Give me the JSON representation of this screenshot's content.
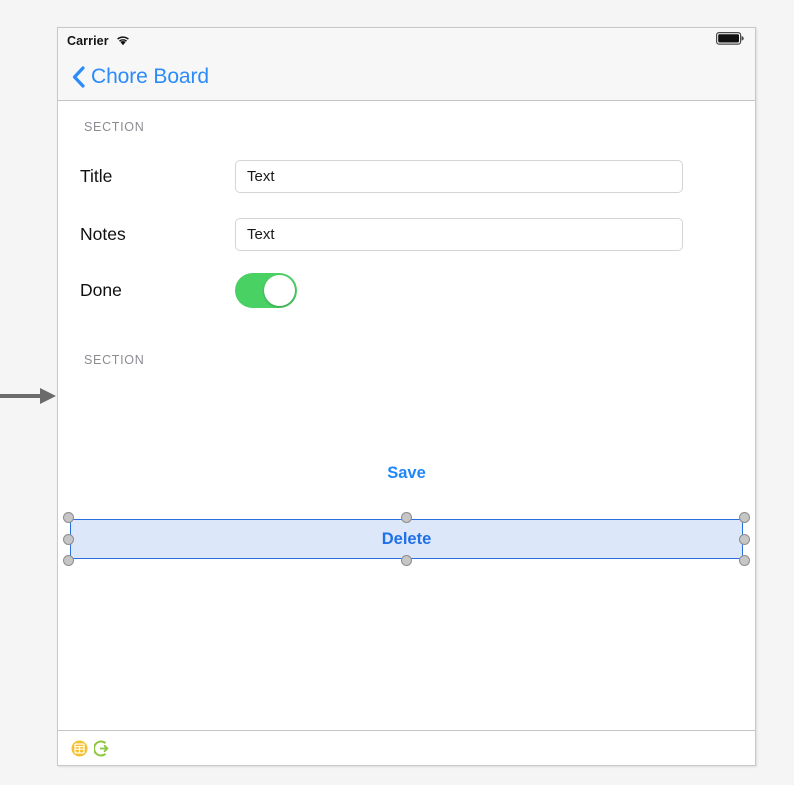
{
  "annotation": {
    "arrow": "right-arrow",
    "color": "#6b6b6b"
  },
  "device": {
    "status_bar": {
      "carrier": "Carrier",
      "wifi_icon": "wifi-icon",
      "battery_icon": "battery-full-icon"
    },
    "nav_bar": {
      "back_icon": "chevron-left-icon",
      "back_label": "Chore Board"
    },
    "form": {
      "section_one_header": "SECTION",
      "section_two_header": "SECTION",
      "rows": [
        {
          "label": "Title",
          "value": "Text",
          "placeholder": "Text"
        },
        {
          "label": "Notes",
          "value": "Text",
          "placeholder": "Text"
        }
      ],
      "toggle_row": {
        "label": "Done",
        "state": "on",
        "on_color": "#4ad164"
      }
    },
    "actions": {
      "save_label": "Save",
      "delete_label": "Delete",
      "accent_color": "#1f86fa",
      "selection_border": "#2a6fe0",
      "selection_fill": "#dde7fa"
    },
    "dock": {
      "items": [
        {
          "icon": "view-controller-icon",
          "color": "#f5c133"
        },
        {
          "icon": "exit-segue-icon",
          "color": "#8cc63f"
        }
      ]
    }
  }
}
